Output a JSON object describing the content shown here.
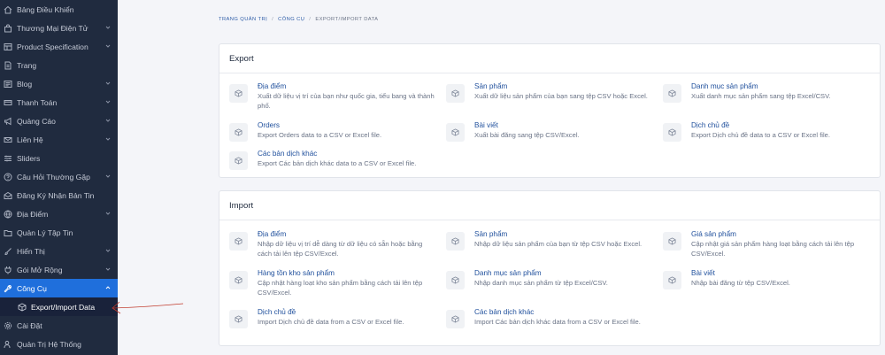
{
  "sidebar": {
    "items": [
      {
        "label": "Bảng Điều Khiển"
      },
      {
        "label": "Thương Mại Điện Tử"
      },
      {
        "label": "Product Specification"
      },
      {
        "label": "Trang"
      },
      {
        "label": "Blog"
      },
      {
        "label": "Thanh Toán"
      },
      {
        "label": "Quảng Cáo"
      },
      {
        "label": "Liên Hệ"
      },
      {
        "label": "Sliders"
      },
      {
        "label": "Câu Hỏi Thường Gặp"
      },
      {
        "label": "Đăng Ký Nhận Bản Tin"
      },
      {
        "label": "Địa Điểm"
      },
      {
        "label": "Quản Lý Tập Tin"
      },
      {
        "label": "Hiển Thị"
      },
      {
        "label": "Gói Mở Rộng"
      },
      {
        "label": "Công Cụ"
      }
    ],
    "subitem": {
      "label": "Export/Import Data"
    },
    "bottom_items": [
      {
        "label": "Cài Đặt"
      },
      {
        "label": "Quản Trị Hệ Thống"
      }
    ]
  },
  "breadcrumb": {
    "home": "TRANG QUẢN TRỊ",
    "tools": "CÔNG CỤ",
    "current": "EXPORT/IMPORT DATA"
  },
  "export": {
    "title": "Export",
    "items": [
      {
        "title": "Địa điểm",
        "desc": "Xuất dữ liệu vị trí của bạn như quốc gia, tiểu bang và thành phố."
      },
      {
        "title": "Sản phẩm",
        "desc": "Xuất dữ liệu sản phẩm của bạn sang tệp CSV hoặc Excel."
      },
      {
        "title": "Danh mục sản phẩm",
        "desc": "Xuất danh mục sản phẩm sang tệp Excel/CSV."
      },
      {
        "title": "Orders",
        "desc": "Export Orders data to a CSV or Excel file."
      },
      {
        "title": "Bài viết",
        "desc": "Xuất bài đăng sang tệp CSV/Excel."
      },
      {
        "title": "Dịch chủ đề",
        "desc": "Export Dịch chủ đề data to a CSV or Excel file."
      },
      {
        "title": "Các bản dịch khác",
        "desc": "Export Các bản dịch khác data to a CSV or Excel file."
      }
    ]
  },
  "import": {
    "title": "Import",
    "items": [
      {
        "title": "Địa điểm",
        "desc": "Nhập dữ liệu vị trí dễ dàng từ dữ liệu có sẵn hoặc bằng cách tải lên tệp CSV/Excel."
      },
      {
        "title": "Sản phẩm",
        "desc": "Nhập dữ liệu sản phẩm của bạn từ tệp CSV hoặc Excel."
      },
      {
        "title": "Giá sản phẩm",
        "desc": "Cập nhật giá sản phẩm hàng loạt bằng cách tải lên tệp CSV/Excel."
      },
      {
        "title": "Hàng tồn kho sản phẩm",
        "desc": "Cập nhật hàng loạt kho sản phẩm bằng cách tải lên tệp CSV/Excel."
      },
      {
        "title": "Danh mục sản phẩm",
        "desc": "Nhập danh mục sản phẩm từ tệp Excel/CSV."
      },
      {
        "title": "Bài viết",
        "desc": "Nhập bài đăng từ tệp CSV/Excel."
      },
      {
        "title": "Dịch chủ đề",
        "desc": "Import Dịch chủ đề data from a CSV or Excel file."
      },
      {
        "title": "Các bản dịch khác",
        "desc": "Import Các bản dịch khác data from a CSV or Excel file."
      }
    ]
  },
  "colors": {
    "sidebar_bg": "#202b3f",
    "active": "#1f6fdc",
    "link": "#1f4f9c",
    "annotation": "#c0392b"
  }
}
